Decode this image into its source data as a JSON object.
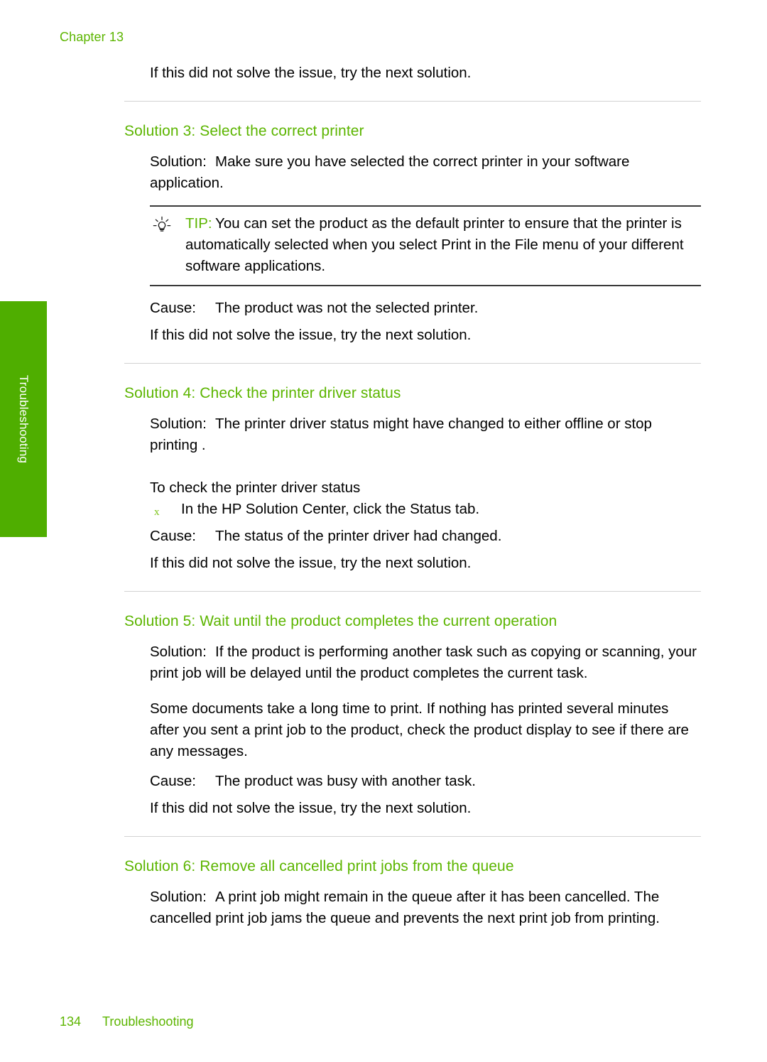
{
  "header": {
    "chapter_label": "Chapter 13"
  },
  "side_tab": {
    "label": "Troubleshooting",
    "color": "#4fae00"
  },
  "theme": {
    "accent_green": "#5cb500",
    "bullet_green": "#7cc417",
    "rule_gray": "#d2d2d2",
    "tip_rule": "#3a3a3a"
  },
  "intro": {
    "next_solution": "If this did not solve the issue, try the next solution."
  },
  "sections": [
    {
      "title": "Solution 3: Select the correct printer",
      "solution_lead": "Solution:",
      "solution_text": "Make sure you have selected the correct printer in your software application.",
      "tip": {
        "icon": "lightbulb-icon",
        "label": "TIP:",
        "text": "You can set the product as the default printer to ensure that the printer is automatically selected when you select Print  in the File  menu of your different software applications."
      },
      "cause_lead": "Cause:",
      "cause_text": "The product was not the selected printer.",
      "next_solution": "If this did not solve the issue, try the next solution."
    },
    {
      "title": "Solution 4: Check the printer driver status",
      "solution_lead": "Solution:",
      "solution_text": "The printer driver status might have changed to either offline  or stop printing .",
      "procedure_heading": "To check the printer driver status",
      "steps": [
        {
          "marker": "x",
          "text": "In the HP Solution Center, click the Status  tab."
        }
      ],
      "cause_lead": "Cause:",
      "cause_text": "The status of the printer driver had changed.",
      "next_solution": "If this did not solve the issue, try the next solution."
    },
    {
      "title": "Solution 5: Wait until the product completes the current operation",
      "solution_lead": "Solution:",
      "solution_text": "If the product is performing another task such as copying or scanning, your print job will be delayed until the product completes the current task.",
      "extra_paragraph": "Some documents take a long time to print. If nothing has printed several minutes after you sent a print job to the product, check the product display to see if there are any messages.",
      "cause_lead": "Cause:",
      "cause_text": "The product was busy with another task.",
      "next_solution": "If this did not solve the issue, try the next solution."
    },
    {
      "title": "Solution 6: Remove all cancelled print jobs from the queue",
      "solution_lead": "Solution:",
      "solution_text": "A print job might remain in the queue after it has been cancelled. The cancelled print job jams the queue and prevents the next print job from printing."
    }
  ],
  "footer": {
    "page_number": "134",
    "section_name": "Troubleshooting"
  }
}
